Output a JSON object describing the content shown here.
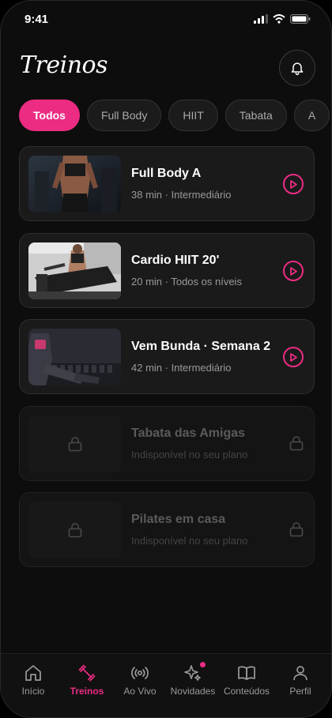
{
  "status": {
    "time": "9:41"
  },
  "header": {
    "title": "Treinos"
  },
  "chips": [
    {
      "label": "Todos",
      "active": true
    },
    {
      "label": "Full Body"
    },
    {
      "label": "HIIT"
    },
    {
      "label": "Tabata"
    },
    {
      "label": "A"
    }
  ],
  "workouts": [
    {
      "title": "Full Body A",
      "meta": "38 min · Intermediário",
      "locked": false
    },
    {
      "title": "Cardio HIIT 20'",
      "meta": "20 min · Todos os níveis",
      "locked": false
    },
    {
      "title": "Vem Bunda · Semana 2",
      "meta": "42 min · Intermediário",
      "locked": false
    },
    {
      "title": "Tabata das Amigas",
      "meta": "Indisponível no seu plano",
      "locked": true
    },
    {
      "title": "Pilates em casa",
      "meta": "Indisponível no seu plano",
      "locked": true
    }
  ],
  "tabs": [
    {
      "label": "Início",
      "icon": "home-icon"
    },
    {
      "label": "Treinos",
      "icon": "dumbbell-icon",
      "active": true
    },
    {
      "label": "Ao Vivo",
      "icon": "live-icon"
    },
    {
      "label": "Novidades",
      "icon": "sparkle-icon",
      "badge": true
    },
    {
      "label": "Conteúdos",
      "icon": "book-icon"
    },
    {
      "label": "Perfil",
      "icon": "user-icon"
    }
  ],
  "colors": {
    "accent": "#ec2c83",
    "background": "#0d0d0d",
    "card": "#1a1a1a"
  }
}
